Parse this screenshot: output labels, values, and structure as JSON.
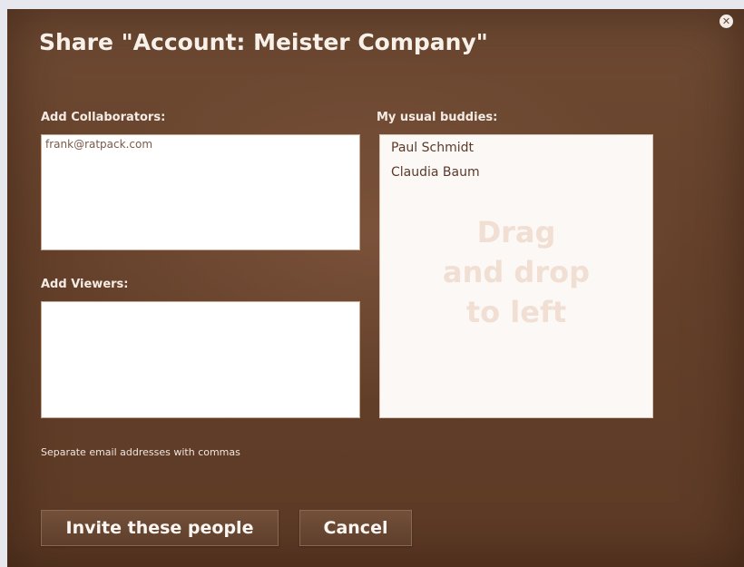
{
  "dialog": {
    "title": "Share \"Account: Meister Company\"",
    "close_icon": "close-icon"
  },
  "collaborators": {
    "label": "Add Collaborators:",
    "value": "frank@ratpack.com"
  },
  "viewers": {
    "label": "Add Viewers:",
    "value": ""
  },
  "buddies": {
    "label": "My usual buddies:",
    "items": [
      "Paul Schmidt",
      "Claudia Baum"
    ],
    "drag_hint_lines": [
      "Drag",
      "and drop",
      "to left"
    ]
  },
  "hint": "Separate email addresses with commas",
  "buttons": {
    "invite": "Invite these people",
    "cancel": "Cancel"
  }
}
